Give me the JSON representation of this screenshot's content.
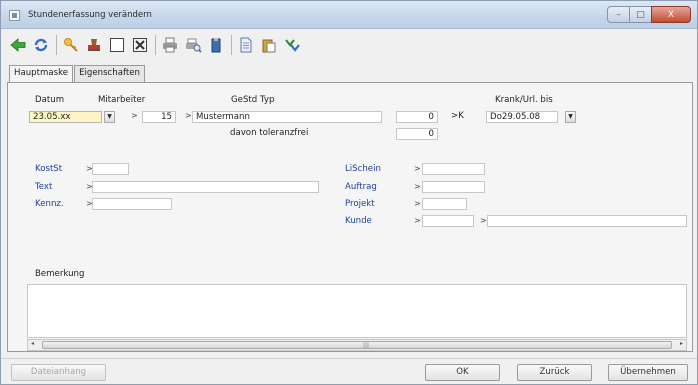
{
  "window": {
    "title": "Stundenerfassung verändern"
  },
  "titlebar_buttons": {
    "minimize": "–",
    "maximize": "□",
    "close": "X"
  },
  "tabs": [
    {
      "label": "Hauptmaske"
    },
    {
      "label": "Eigenschaften"
    }
  ],
  "header_labels": {
    "datum": "Datum",
    "mitarbeiter": "Mitarbeiter",
    "gestd_typ": "GeStd Typ",
    "krank_url_bis": "Krank/Url. bis"
  },
  "row1": {
    "datum_value": "23.05.xx",
    "arrow1": ">",
    "mitarbeiter_value": "15",
    "arrow2": ">",
    "name_value": "Mustermann",
    "gestd_value": "0",
    "typ_prefix": ">K",
    "krank_value": "Do29.05.08"
  },
  "row2": {
    "label": "davon toleranzfrei",
    "value": "0"
  },
  "left_fields": [
    {
      "label": "KostSt",
      "arrow": ">",
      "value": ""
    },
    {
      "label": "Text",
      "arrow": ">",
      "value": ""
    },
    {
      "label": "Kennz.",
      "arrow": ">",
      "value": ""
    }
  ],
  "right_fields": [
    {
      "label": "LiSchein",
      "arrow": ">",
      "value": ""
    },
    {
      "label": "Auftrag",
      "arrow": ">",
      "value": ""
    },
    {
      "label": "Projekt",
      "arrow": ">",
      "value": ""
    },
    {
      "label": "Kunde",
      "arrow": ">",
      "value": "",
      "arrow2": ">",
      "value2": ""
    }
  ],
  "bemerkung": {
    "label": "Bemerkung",
    "value": ""
  },
  "scroll": {
    "left": "◂",
    "grip": "|||",
    "right": "▸"
  },
  "buttons": {
    "dateianhang": "Dateianhang",
    "ok": "OK",
    "zurueck": "Zurück",
    "uebernehmen": "Übernehmen"
  }
}
